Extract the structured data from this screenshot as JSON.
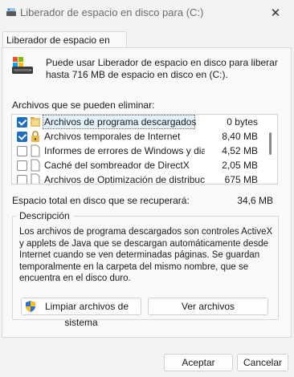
{
  "window": {
    "title": "Liberador de espacio en disco para  (C:)",
    "close_glyph": "✕"
  },
  "tab": {
    "label": "Liberador de espacio en disco"
  },
  "intro": {
    "text": "Puede usar Liberador de espacio en disco para liberar hasta 716 MB de espacio en disco en  (C:).",
    "icon": "drive-icon"
  },
  "files": {
    "label": "Archivos que se pueden eliminar:",
    "items": [
      {
        "name": "Archivos de programa descargados",
        "size": "0 bytes",
        "checked": true,
        "icon": "folder-icon"
      },
      {
        "name": "Archivos temporales de Internet",
        "size": "8,40 MB",
        "checked": true,
        "icon": "lock-icon"
      },
      {
        "name": "Informes de errores de Windows y diag...",
        "size": "4,52 MB",
        "checked": false,
        "icon": "document-icon"
      },
      {
        "name": "Caché del sombreador de DirectX",
        "size": "2,05 MB",
        "checked": false,
        "icon": "document-icon"
      },
      {
        "name": "Archivos de Optimización de distribución",
        "size": "675 MB",
        "checked": false,
        "icon": "document-icon"
      }
    ]
  },
  "total": {
    "label": "Espacio total en disco que se recuperará:",
    "amount": "34,6 MB"
  },
  "description": {
    "label": "Descripción",
    "text": "Los archivos de programa descargados son controles ActiveX y applets de Java que se descargan automáticamente desde Internet cuando se ven determinadas páginas. Se guardan temporalmente en la carpeta del mismo nombre, que se encuentra en el disco duro."
  },
  "buttons": {
    "cleanup": "Limpiar archivos de sistema",
    "view": "Ver archivos",
    "accept": "Aceptar",
    "cancel": "Cancelar"
  },
  "colors": {
    "accent": "#1a6fc4"
  }
}
